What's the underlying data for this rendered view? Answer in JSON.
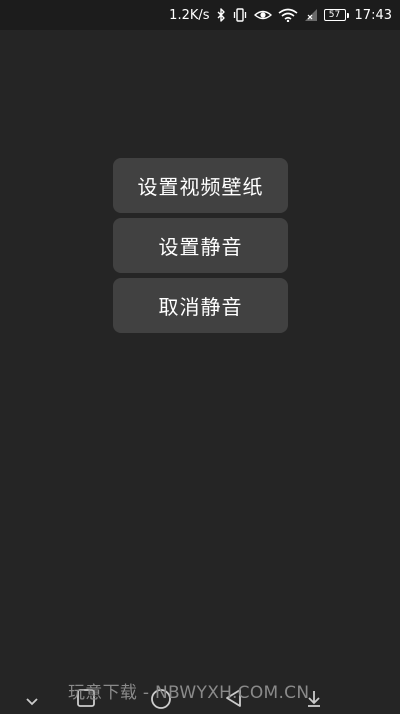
{
  "status_bar": {
    "net_speed": "1.2K/s",
    "battery_level": "57",
    "time": "17:43",
    "icons": [
      "bluetooth-icon",
      "vibrate-icon",
      "eye-icon",
      "wifi-icon",
      "signal-icon",
      "battery-icon"
    ]
  },
  "menu": {
    "items": [
      {
        "label": "设置视频壁纸"
      },
      {
        "label": "设置静音"
      },
      {
        "label": "取消静音"
      }
    ]
  },
  "watermark": "玩意下载 - NBWYXH.COM.CN",
  "colors": {
    "background": "#252525",
    "button": "#414141",
    "text": "#ffffff"
  }
}
